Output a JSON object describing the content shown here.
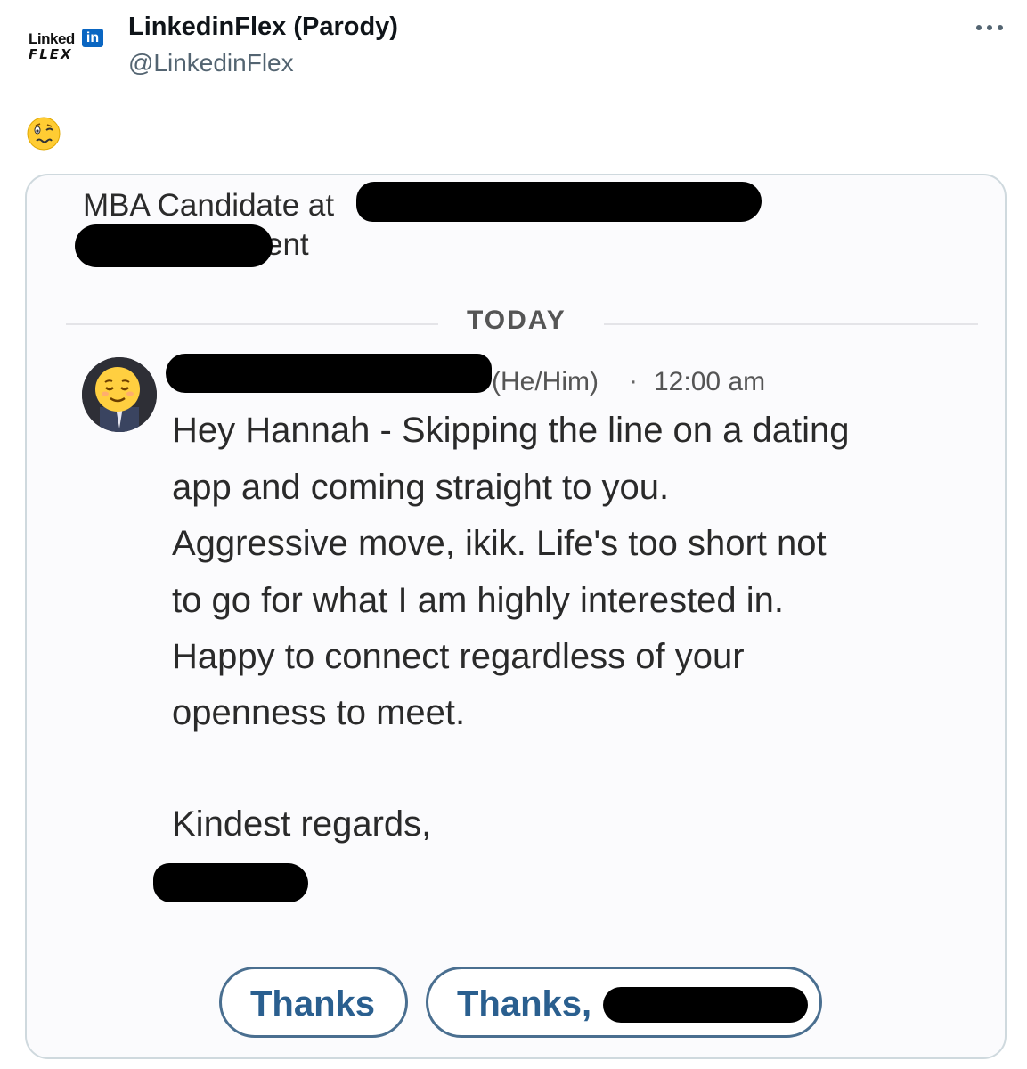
{
  "tweet": {
    "display_name": "LinkedinFlex (Parody)",
    "handle": "@LinkedinFlex",
    "emoji_icon": "woozy-face-emoji",
    "logo": {
      "text_top": "Linked",
      "text_in": "in",
      "text_bottom": "FLEX"
    }
  },
  "screenshot": {
    "headline_line1": "MBA Candidate at",
    "headline_line2": "ent",
    "divider_label": "TODAY",
    "sender": {
      "pronouns": "(He/Him)",
      "separator": "·",
      "time": "12:00 am",
      "avatar_icon": "relieved-face-avatar"
    },
    "message_lines": [
      "Hey Hannah - Skipping the line on a dating",
      "app and coming straight to you.",
      "Aggressive move, ikik. Life's too short not",
      "to go for what I am highly interested in.",
      "Happy to connect regardless of your",
      "openness to meet.",
      "Kindest regards,"
    ],
    "quick_replies": [
      "Thanks",
      "Thanks,"
    ]
  },
  "colors": {
    "linkedin_blue": "#0a66c2",
    "button_text": "#2a5f8f",
    "redaction": "#000000"
  }
}
